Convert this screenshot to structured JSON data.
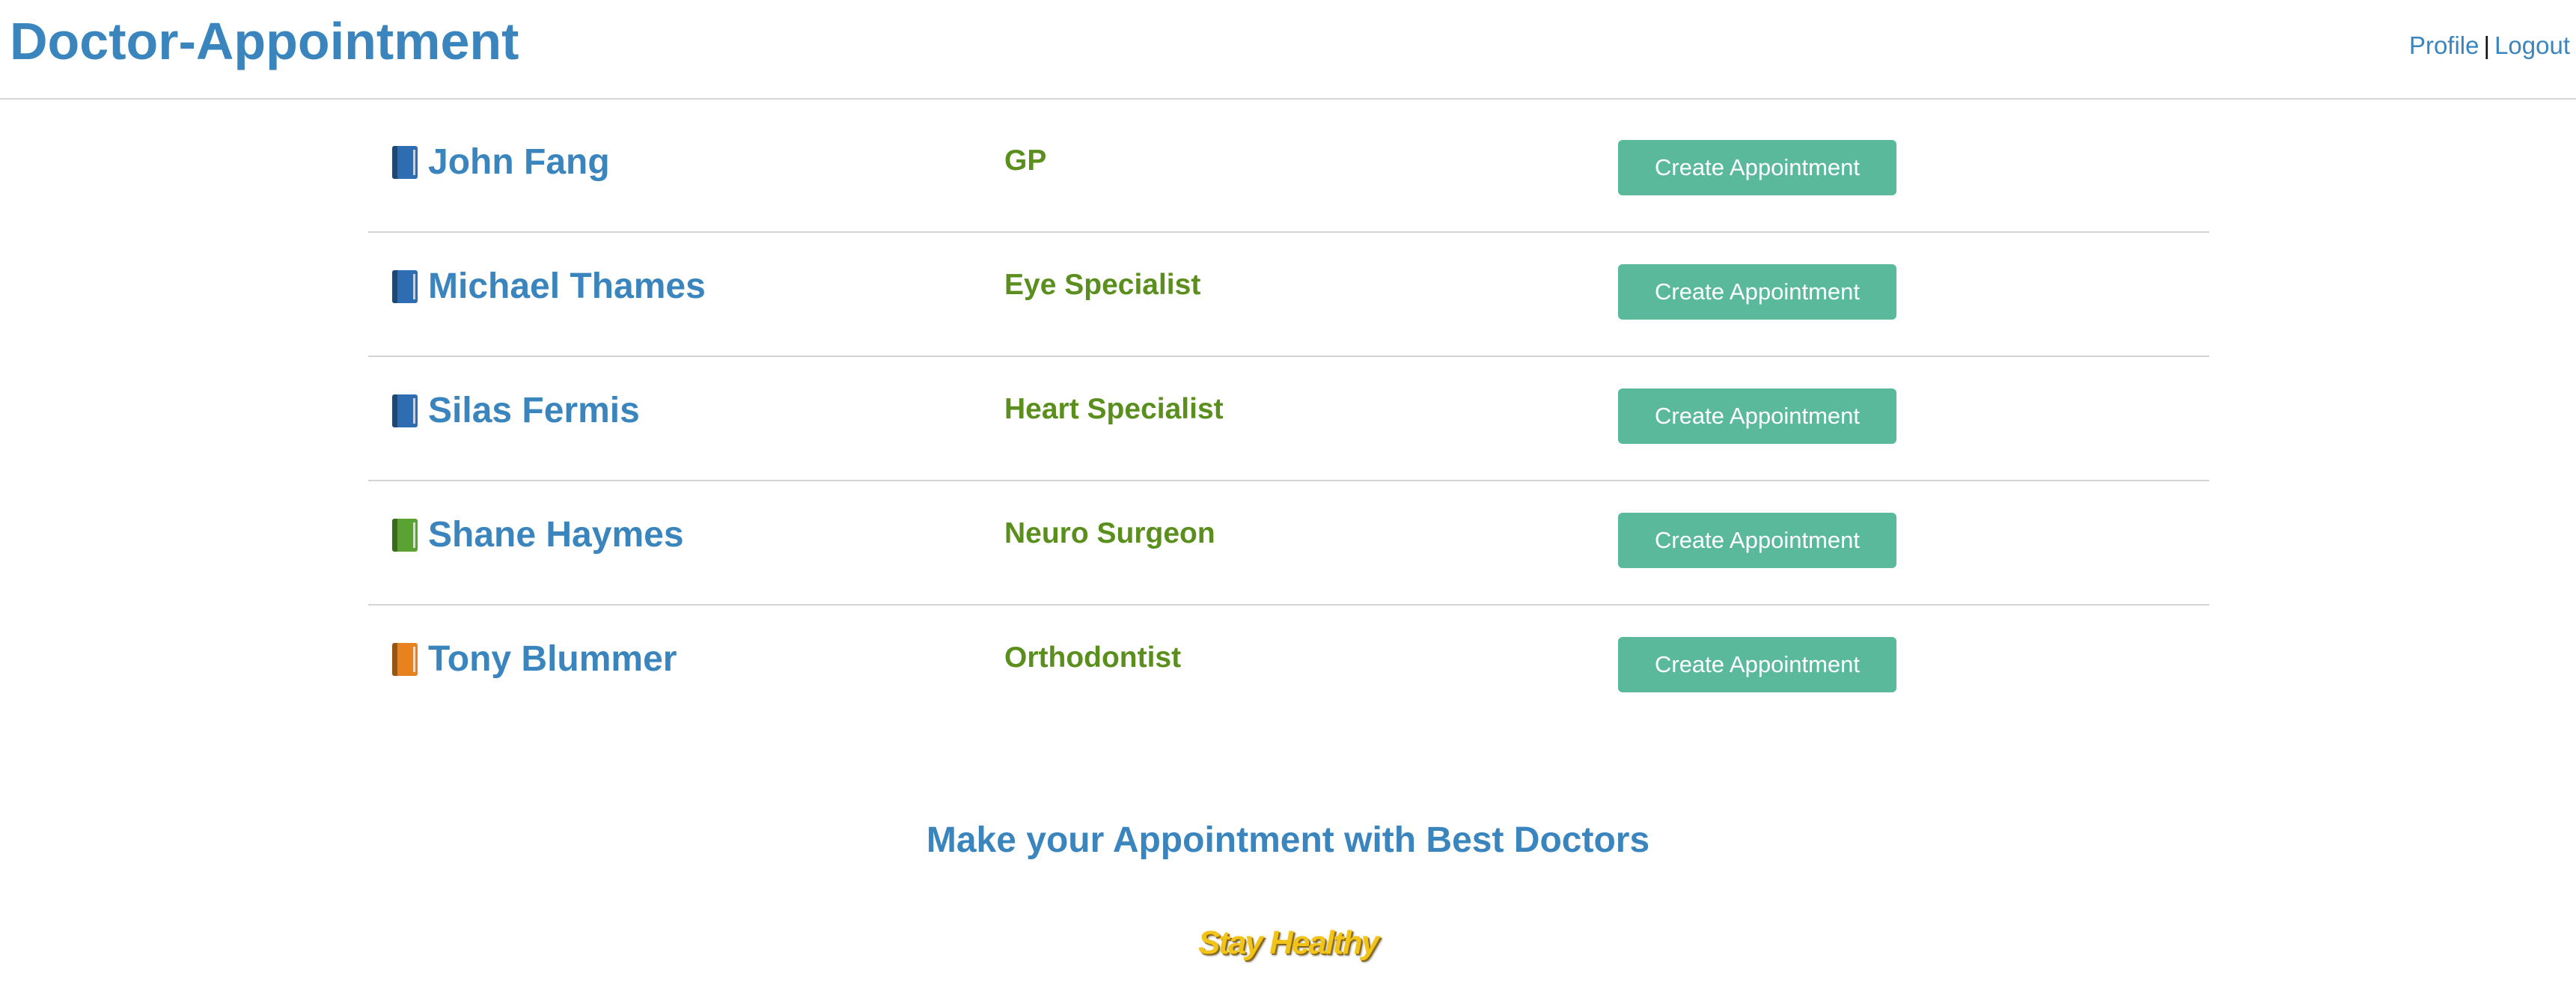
{
  "header": {
    "title": "Doctor-Appointment",
    "nav": {
      "profile": "Profile",
      "separator": "|",
      "logout": "Logout"
    }
  },
  "doctors": [
    {
      "name": "John Fang",
      "specialty": "GP",
      "button": "Create Appointment",
      "icon": "blue-book-icon",
      "icon_color": "#2f6db3"
    },
    {
      "name": "Michael Thames",
      "specialty": "Eye Specialist",
      "button": "Create Appointment",
      "icon": "blue-book-icon",
      "icon_color": "#2f6db3"
    },
    {
      "name": "Silas Fermis",
      "specialty": "Heart Specialist",
      "button": "Create Appointment",
      "icon": "blue-book-icon",
      "icon_color": "#2f6db3"
    },
    {
      "name": "Shane Haymes",
      "specialty": "Neuro Surgeon",
      "button": "Create Appointment",
      "icon": "green-book-icon",
      "icon_color": "#5aa332"
    },
    {
      "name": "Tony Blummer",
      "specialty": "Orthodontist",
      "button": "Create Appointment",
      "icon": "orange-book-icon",
      "icon_color": "#e8821e"
    }
  ],
  "footer": {
    "tagline": "Make your Appointment with Best Doctors",
    "slogan": "Stay Healthy"
  },
  "colors": {
    "brand_blue": "#3a85bd",
    "specialty_green": "#5a8f1e",
    "button_green": "#5bb99b",
    "slogan_yellow": "#f2c318"
  }
}
